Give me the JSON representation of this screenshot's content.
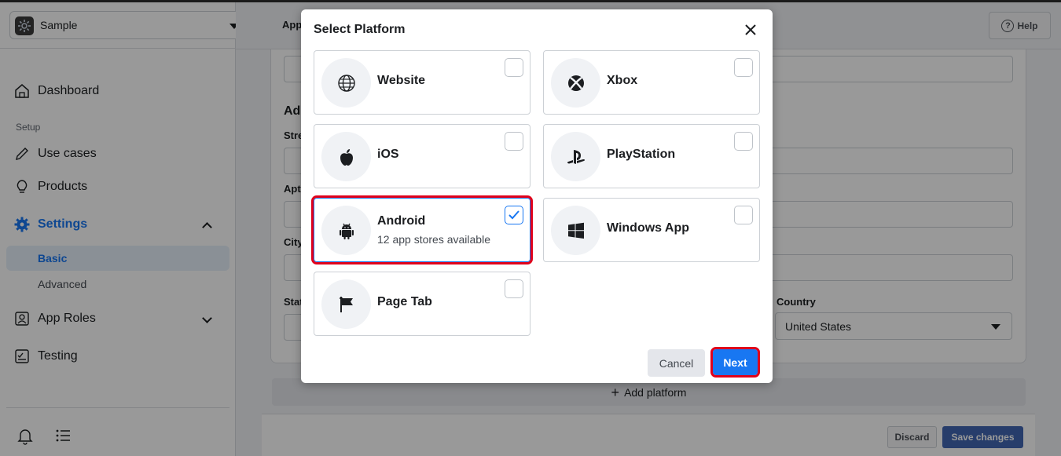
{
  "sidebar": {
    "app_name": "Sample",
    "items": [
      {
        "label": "Dashboard"
      },
      {
        "section": "Setup"
      },
      {
        "label": "Use cases"
      },
      {
        "label": "Products"
      },
      {
        "label": "Settings"
      },
      {
        "label": "Basic"
      },
      {
        "label": "Advanced"
      },
      {
        "label": "App Roles"
      },
      {
        "label": "Testing"
      }
    ]
  },
  "header": {
    "help_label": "Help",
    "fragment_app": "App"
  },
  "form": {
    "fragment_address": "Add",
    "fragment_street": "Stre",
    "fragment_apt": "Apt",
    "fragment_city": "City",
    "fragment_state": "Stat",
    "country_label": "Country",
    "country_value": "United States"
  },
  "add_platform_label": "Add platform",
  "footer": {
    "discard_label": "Discard",
    "save_label": "Save changes"
  },
  "modal": {
    "title": "Select Platform",
    "platforms": [
      {
        "name": "Website",
        "checked": false
      },
      {
        "name": "Xbox",
        "checked": false
      },
      {
        "name": "iOS",
        "checked": false
      },
      {
        "name": "PlayStation",
        "checked": false
      },
      {
        "name": "Android",
        "sub": "12 app stores available",
        "checked": true
      },
      {
        "name": "Windows App",
        "checked": false
      },
      {
        "name": "Page Tab",
        "checked": false
      }
    ],
    "cancel_label": "Cancel",
    "next_label": "Next"
  },
  "colors": {
    "accent": "#1877f2",
    "highlight": "#e0001b",
    "save": "#4267b2"
  }
}
